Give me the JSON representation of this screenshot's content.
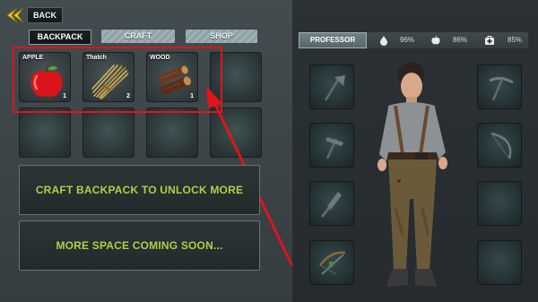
{
  "header": {
    "back_label": "BACK"
  },
  "tabs": [
    {
      "label": "BACKPACK",
      "active": true
    },
    {
      "label": "CRAFT",
      "active": false
    },
    {
      "label": "SHOP",
      "active": false
    }
  ],
  "inventory": {
    "items": [
      {
        "name": "APPLE",
        "count": "1",
        "icon": "apple-icon"
      },
      {
        "name": "Thatch",
        "count": "2",
        "icon": "thatch-icon"
      },
      {
        "name": "WOOD",
        "count": "1",
        "icon": "wood-icon"
      }
    ],
    "empty_slots": 5
  },
  "banners": {
    "craft_backpack": "CRAFT BACKPACK TO UNLOCK MORE SPACE",
    "more_space": "MORE SPACE COMING SOON..."
  },
  "character": {
    "name_tab": "PROFESSOR",
    "stats": [
      {
        "icon": "water-drop-icon",
        "value": "96%"
      },
      {
        "icon": "apple-food-icon",
        "value": "86%"
      },
      {
        "icon": "medkit-icon",
        "value": "85%"
      }
    ]
  },
  "equipment": {
    "left_slots": [
      "axe-icon",
      "hammer-icon",
      "knife-icon",
      "crossbow-icon"
    ],
    "right_slots": [
      "pickaxe-icon",
      "bow-icon",
      "empty",
      "empty"
    ]
  },
  "colors": {
    "accent_green": "#b1cf46",
    "back_arrow_yellow": "#f4c51e",
    "highlight_red": "#e0141b"
  }
}
